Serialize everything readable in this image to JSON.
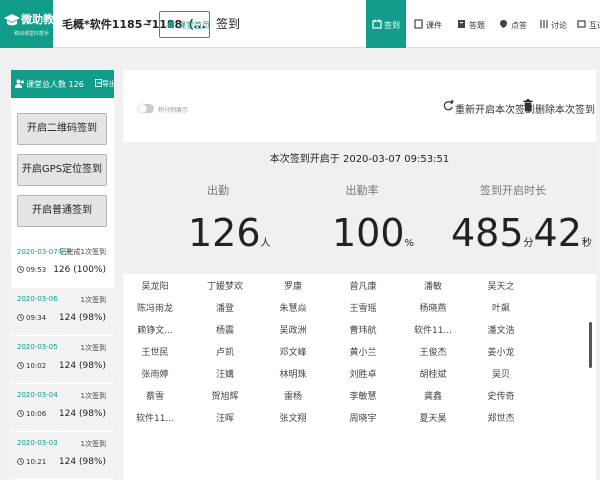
{
  "logo": {
    "name": "微助教",
    "slogan": "移动课堂好帮手"
  },
  "header": {
    "course": "毛概*软件1185~1188（...",
    "home_button": "课堂首页",
    "page_title": "签到",
    "nav": [
      {
        "label": "签到",
        "icon": "checkin-icon",
        "active": true
      },
      {
        "label": "课件",
        "icon": "courseware-icon",
        "active": false
      },
      {
        "label": "答题",
        "icon": "quiz-icon",
        "active": false
      },
      {
        "label": "点答",
        "icon": "pick-icon",
        "active": false
      },
      {
        "label": "讨论",
        "icon": "discussion-icon",
        "active": false
      },
      {
        "label": "互评",
        "icon": "peer-review-icon",
        "active": false
      }
    ]
  },
  "sidebar": {
    "total_label": "课堂总人数 126",
    "export_label": "导出",
    "buttons": [
      "开启二维码签到",
      "开启GPS定位签到",
      "开启普通签到"
    ],
    "records": [
      {
        "date": "2020-03-07今天",
        "status": "已完成1次签到",
        "time": "09:53",
        "result": "126 (100%)"
      },
      {
        "date": "2020-03-06",
        "status": "1次签到",
        "time": "09:34",
        "result": "124 (98%)"
      },
      {
        "date": "2020-03-05",
        "status": "1次签到",
        "time": "10:02",
        "result": "124 (98%)"
      },
      {
        "date": "2020-03-04",
        "status": "1次签到",
        "time": "10:06",
        "result": "124 (98%)"
      },
      {
        "date": "2020-03-03",
        "status": "1次签到",
        "time": "10:21",
        "result": "124 (98%)"
      }
    ]
  },
  "main": {
    "toggle_label": "积分制展示",
    "restart_label": "重新开启本次签到",
    "delete_label": "删除本次签到",
    "start_text": "本次签到开启于 2020-03-07 09:53:51",
    "stats": {
      "attendance_label": "出勤",
      "attendance_value": "126",
      "attendance_unit": "人",
      "rate_label": "出勤率",
      "rate_value": "100",
      "rate_unit": "%",
      "duration_label": "签到开启时长",
      "duration_min": "485",
      "duration_min_unit": "分",
      "duration_sec": "42",
      "duration_sec_unit": "秒"
    },
    "names": [
      [
        "吴龙阳",
        "丁媛梦欢",
        "罗康",
        "曾凡康",
        "潘敏",
        "吴天之"
      ],
      [
        "陈冯雨龙",
        "潘登",
        "朱慧焱",
        "王雪瑶",
        "杨晓燕",
        "叶飙"
      ],
      [
        "赖铮文...",
        "杨震",
        "吴政洲",
        "曹玮航",
        "软件11...",
        "潘文浩"
      ],
      [
        "王世民",
        "卢凯",
        "邓文峰",
        "黄小兰",
        "王俊杰",
        "姜小龙"
      ],
      [
        "张雨婷",
        "汪媾",
        "林明珠",
        "刘胜卓",
        "胡桂斌",
        "吴贝"
      ],
      [
        "蔡雪",
        "贺旭辉",
        "雷杨",
        "李敏慧",
        "龚鑫",
        "史传奇"
      ],
      [
        "软件11...",
        "汪晖",
        "张文翔",
        "周晓宇",
        "夏天昊",
        "郑世杰"
      ]
    ]
  }
}
